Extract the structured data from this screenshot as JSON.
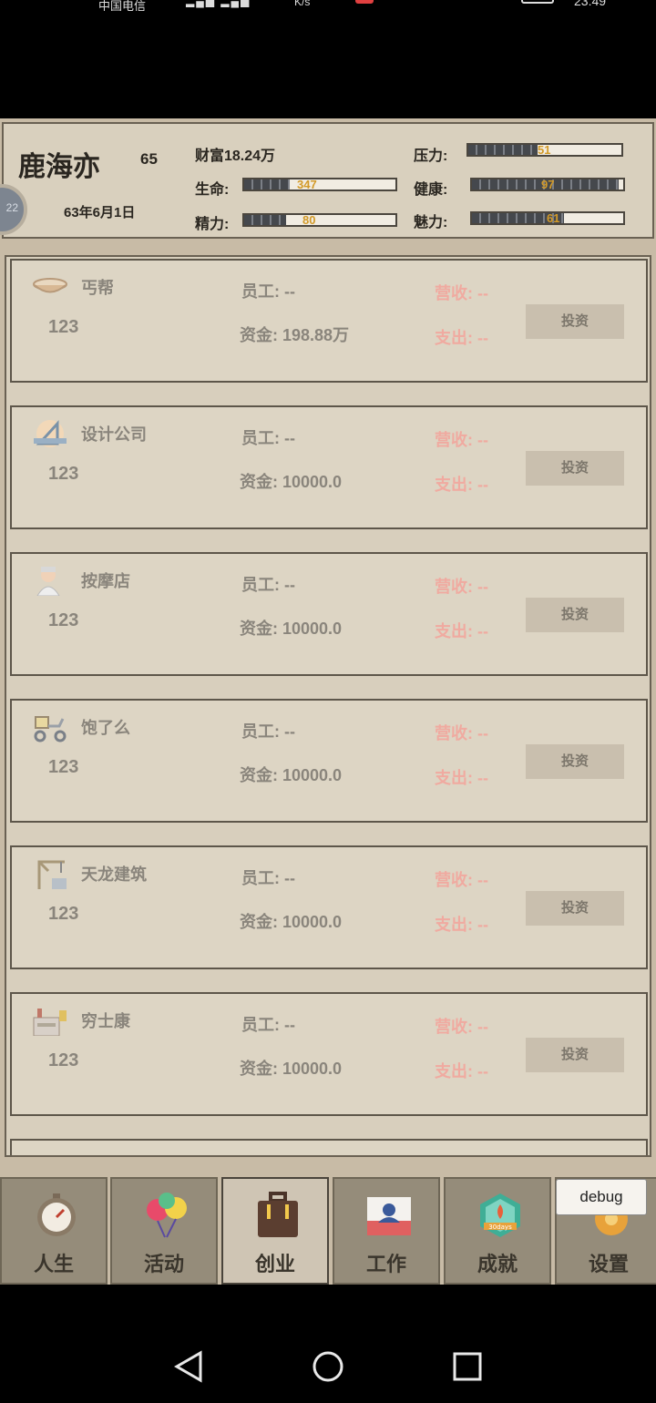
{
  "status_bar": {
    "carrier": "中国电信",
    "speed": "K/s",
    "time": "23:49"
  },
  "header": {
    "name": "鹿海亦",
    "age": "65",
    "date": "63年6月1日",
    "avatar_badge": "22",
    "wealth": "财富18.24万",
    "stats": [
      {
        "label": "压力:",
        "value": "51",
        "level": 0.45
      },
      {
        "label": "生命:",
        "value": "347",
        "level": 0.3
      },
      {
        "label": "健康:",
        "value": "97",
        "level": 0.97
      },
      {
        "label": "精力:",
        "value": "80",
        "level": 0.28
      },
      {
        "label": "魅力:",
        "value": "61",
        "level": 0.61
      }
    ]
  },
  "businesses": [
    {
      "title": "丐帮",
      "num": "123",
      "staff": "员工: --",
      "fund": "资金: 198.88万",
      "revenue": "营收: --",
      "expense": "支出: --",
      "button": "投资",
      "icon": "bowl-icon"
    },
    {
      "title": "设计公司",
      "num": "123",
      "staff": "员工: --",
      "fund": "资金: 10000.0",
      "revenue": "营收: --",
      "expense": "支出: --",
      "button": "投资",
      "icon": "ruler-triangle-icon"
    },
    {
      "title": "按摩店",
      "num": "123",
      "staff": "员工: --",
      "fund": "资金: 10000.0",
      "revenue": "营收: --",
      "expense": "支出: --",
      "button": "投资",
      "icon": "masseur-icon"
    },
    {
      "title": "饱了么",
      "num": "123",
      "staff": "员工: --",
      "fund": "资金: 10000.0",
      "revenue": "营收: --",
      "expense": "支出: --",
      "button": "投资",
      "icon": "scooter-icon"
    },
    {
      "title": "天龙建筑",
      "num": "123",
      "staff": "员工: --",
      "fund": "资金: 10000.0",
      "revenue": "营收: --",
      "expense": "支出: --",
      "button": "投资",
      "icon": "crane-icon"
    },
    {
      "title": "穷士康",
      "num": "123",
      "staff": "员工: --",
      "fund": "资金: 10000.0",
      "revenue": "营收: --",
      "expense": "支出: --",
      "button": "投资",
      "icon": "factory-icon"
    }
  ],
  "nav": {
    "tabs": [
      {
        "label": "人生",
        "icon": "stopwatch-icon"
      },
      {
        "label": "活动",
        "icon": "balloons-icon"
      },
      {
        "label": "创业",
        "icon": "briefcase-icon",
        "active": true
      },
      {
        "label": "工作",
        "icon": "id-badge-icon"
      },
      {
        "label": "成就",
        "icon": "achievement-badge-icon",
        "badge_text": "30days"
      },
      {
        "label": "设置",
        "icon": "gear-icon"
      }
    ],
    "debug_label": "debug"
  },
  "colors": {
    "background": "#c8bba6",
    "panel": "#d9d0be",
    "accent_value": "#d39a28",
    "muted_red": "#f0aaa0"
  }
}
